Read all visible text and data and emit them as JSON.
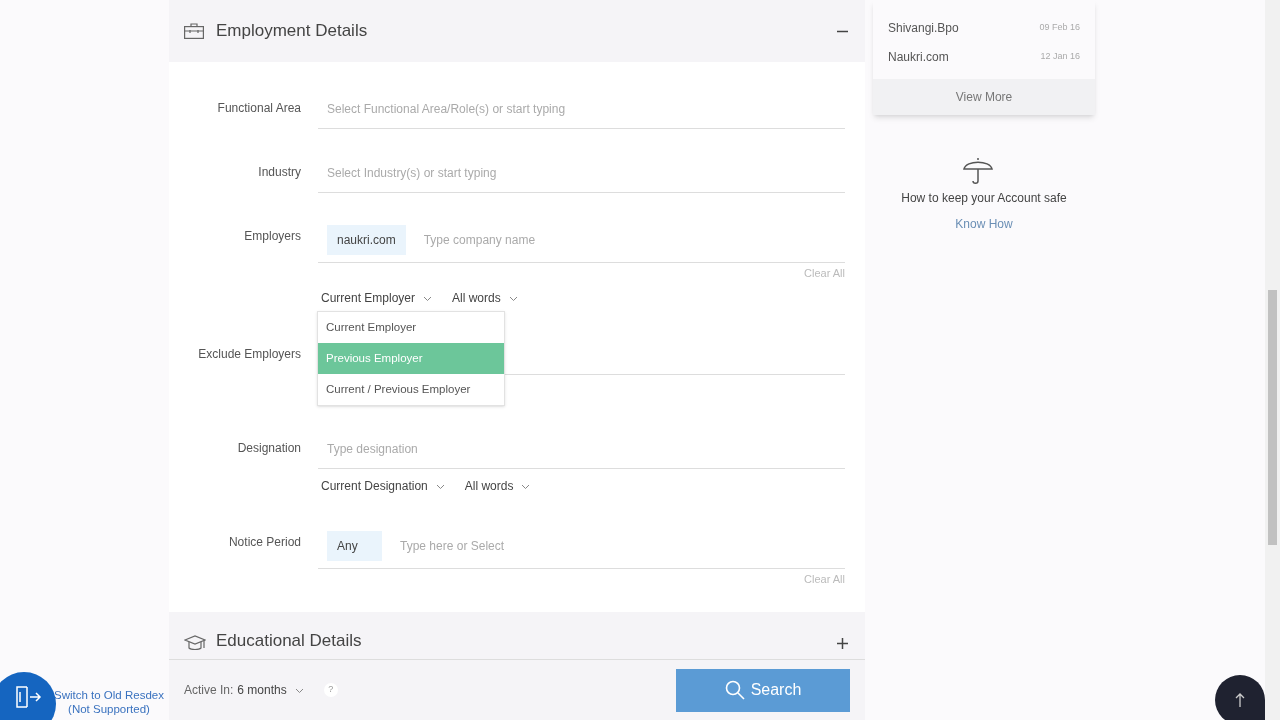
{
  "employment_section": {
    "title": "Employment Details",
    "expanded": true,
    "fields": [
      {
        "label": "Functional Area",
        "placeholder": "Select Functional Area/Role(s) or start typing"
      },
      {
        "label": "Industry",
        "placeholder": "Select Industry(s) or start typing"
      },
      {
        "label": "Employers",
        "chips": [
          "naukri.com"
        ],
        "placeholder": "Type company name",
        "clear_all": "Clear All",
        "selectors": [
          {
            "label": "Current Employer",
            "open": true,
            "options": [
              {
                "label": "Current Employer",
                "selected": false
              },
              {
                "label": "Previous Employer",
                "selected": true
              },
              {
                "label": "Current / Previous Employer",
                "selected": false
              }
            ]
          },
          {
            "label": "All words",
            "open": false
          }
        ]
      },
      {
        "label": "Exclude Employers"
      },
      {
        "label": "Designation",
        "placeholder": "Type designation",
        "selectors": [
          {
            "label": "Current Designation",
            "open": false
          },
          {
            "label": "All words",
            "open": false
          }
        ]
      },
      {
        "label": "Notice Period",
        "chips": [
          "Any"
        ],
        "placeholder": "Type here or Select",
        "clear_all": "Clear All"
      }
    ]
  },
  "educational_section": {
    "title": "Educational Details",
    "expanded": false
  },
  "bottom_bar": {
    "active_in_label": "Active In:",
    "active_in_value": "6 months",
    "help": "?",
    "search_button": "Search"
  },
  "switch_link": {
    "line_1": "Switch to Old Resdex",
    "line_2": "(Not Supported)"
  },
  "recent_searches": {
    "items": [
      {
        "name": "Shivangi.Bpo",
        "date": "09 Feb 16"
      },
      {
        "name": "Naukri.com",
        "date": "12 Jan 16"
      }
    ],
    "view_more": "View More"
  },
  "account_safety": {
    "text": "How to keep your Account safe",
    "link": "Know How"
  }
}
